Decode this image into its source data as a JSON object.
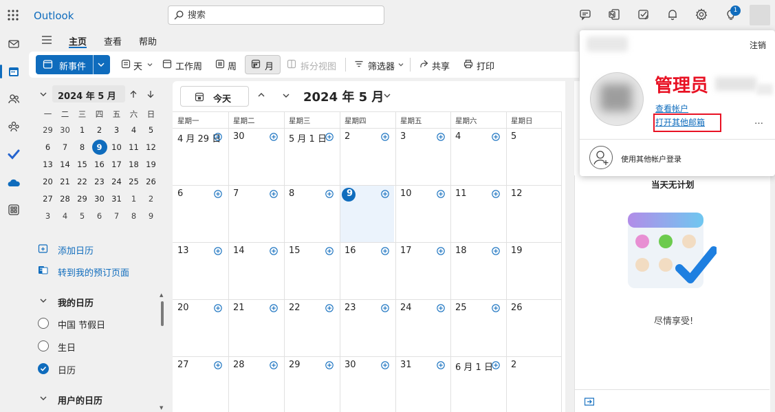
{
  "app": {
    "title": "Outlook"
  },
  "search": {
    "placeholder": "搜索"
  },
  "notifications": {
    "badge_count": "1"
  },
  "ribbon_tabs": {
    "home": "主页",
    "view": "查看",
    "help": "帮助"
  },
  "ribbon": {
    "new_event": "新事件",
    "day": "天",
    "work_week": "工作周",
    "week": "周",
    "month": "月",
    "split_view": "拆分视图",
    "filter": "筛选器",
    "share": "共享",
    "print": "打印"
  },
  "mini_calendar": {
    "title": "2024 年 5 月",
    "weekdays": [
      "一",
      "二",
      "三",
      "四",
      "五",
      "六",
      "日"
    ],
    "weeks": [
      [
        "29",
        "30",
        "1",
        "2",
        "3",
        "4",
        "5"
      ],
      [
        "6",
        "7",
        "8",
        "9",
        "10",
        "11",
        "12"
      ],
      [
        "13",
        "14",
        "15",
        "16",
        "17",
        "18",
        "19"
      ],
      [
        "20",
        "21",
        "22",
        "23",
        "24",
        "25",
        "26"
      ],
      [
        "27",
        "28",
        "29",
        "30",
        "31",
        "1",
        "2"
      ],
      [
        "3",
        "4",
        "5",
        "6",
        "7",
        "8",
        "9"
      ]
    ],
    "today": "9"
  },
  "nav": {
    "add_calendar": "添加日历",
    "booking_page": "转到我的预订页面",
    "my_calendars": "我的日历",
    "items": [
      "中国 节假日",
      "生日",
      "日历"
    ],
    "user_calendars": "用户的日历"
  },
  "calendar": {
    "today_button": "今天",
    "title": "2024 年 5 月",
    "weekdays": [
      "星期一",
      "星期二",
      "星期三",
      "星期四",
      "星期五",
      "星期六",
      "星期日"
    ],
    "weeks": [
      [
        "4 月 29 日",
        "30",
        "5 月 1 日",
        "2",
        "3",
        "4",
        "5"
      ],
      [
        "6",
        "7",
        "8",
        "9",
        "10",
        "11",
        "12"
      ],
      [
        "13",
        "14",
        "15",
        "16",
        "17",
        "18",
        "19"
      ],
      [
        "20",
        "21",
        "22",
        "23",
        "24",
        "25",
        "26"
      ],
      [
        "27",
        "28",
        "29",
        "30",
        "31",
        "6 月 1 日",
        "2"
      ]
    ]
  },
  "agenda": {
    "no_plans": "当天无计划",
    "enjoy": "尽情享受!"
  },
  "account_flyout": {
    "sign_out": "注销",
    "display_name": "管理员",
    "view_account": "查看帐户",
    "open_other_mailbox": "打开其他邮箱",
    "more": "…",
    "sign_in_other": "使用其他帐户登录"
  },
  "colors": {
    "accent": "#0f6cbd",
    "highlight_red": "#e81123"
  }
}
